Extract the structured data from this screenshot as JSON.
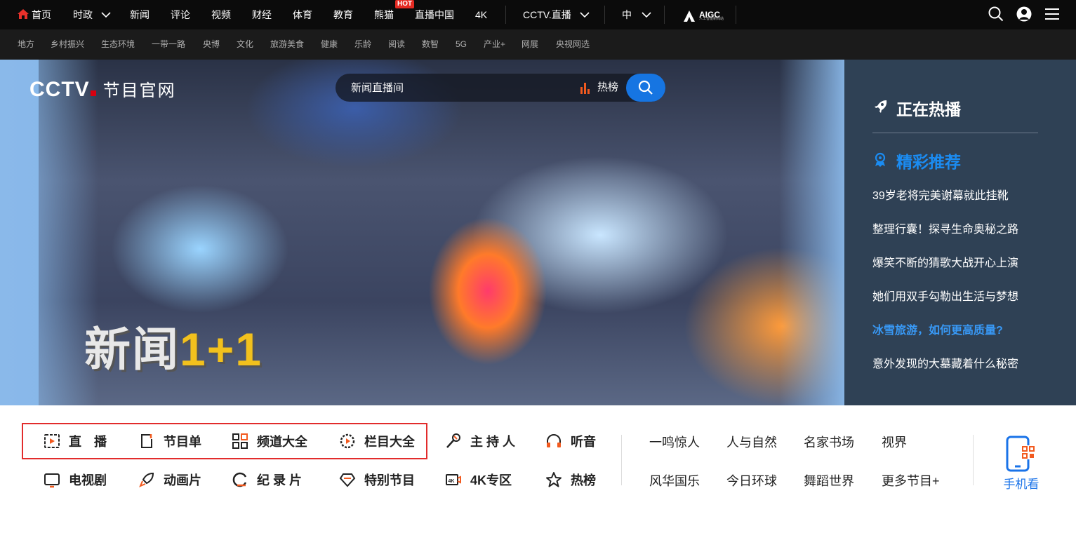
{
  "colors": {
    "accent": "#1675e2",
    "brand_red": "#d7000f",
    "panel": "#2f4155",
    "nav_bg": "#0b0b0b"
  },
  "topnav": {
    "home": "首页",
    "shizheng": "时政",
    "xinwen": "新闻",
    "pinglun": "评论",
    "shipin": "视频",
    "caijing": "财经",
    "tiyu": "体育",
    "jiaoyu": "教育",
    "xiongmao": "熊猫",
    "hot_badge": "HOT",
    "zhibo_china": "直播中国",
    "k4": "4K",
    "cctv_live": "CCTV.直播",
    "lang": "中",
    "aigc": "AIGC",
    "aigc_sub": "人工智能新闻站"
  },
  "subnav": [
    "地方",
    "乡村振兴",
    "生态环境",
    "一带一路",
    "央博",
    "文化",
    "旅游美食",
    "健康",
    "乐龄",
    "阅读",
    "数智",
    "5G",
    "产业+",
    "网展",
    "央视网选"
  ],
  "hero": {
    "logo_text": "CCTV",
    "logo_sub": "节目官网",
    "search_placeholder": "新闻直播间",
    "search_hot": "热榜",
    "headline_text": "新闻",
    "headline_num": "1+1"
  },
  "side_panel": {
    "title": "正在热播",
    "section": "精彩推荐",
    "items": [
      "39岁老将完美谢幕就此挂靴",
      "整理行囊！探寻生命奥秘之路",
      "爆笑不断的猜歌大战开心上演",
      "她们用双手勾勒出生活与梦想",
      "冰雪旅游，如何更高质量?",
      "意外发现的大墓藏着什么秘密"
    ],
    "active_index": 4
  },
  "channel_nav": {
    "row1": [
      "直　播",
      "节目单",
      "频道大全",
      "栏目大全",
      "主 持 人",
      "听音"
    ],
    "row2": [
      "电视剧",
      "动画片",
      "纪 录 片",
      "特别节目",
      "4K专区",
      "热榜"
    ]
  },
  "programs": {
    "row1": [
      "一鸣惊人",
      "人与自然",
      "名家书场",
      "视界"
    ],
    "row2": [
      "风华国乐",
      "今日环球",
      "舞蹈世界",
      "更多节目+"
    ]
  },
  "mobile": {
    "label": "手机看"
  }
}
